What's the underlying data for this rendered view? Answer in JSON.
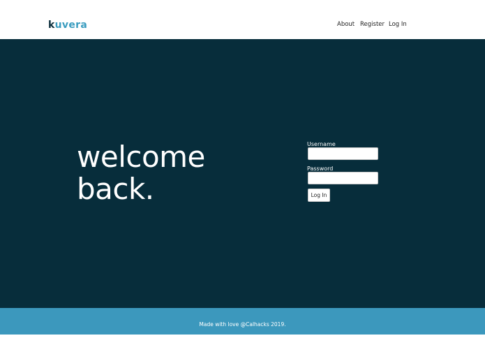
{
  "header": {
    "logo": {
      "first_letter": "k",
      "rest": "uvera"
    },
    "nav": [
      {
        "label": "About"
      },
      {
        "label": "Register"
      },
      {
        "label": "Log In"
      }
    ]
  },
  "hero": {
    "headline": {
      "line1": "welcome",
      "line2": "back."
    }
  },
  "login_form": {
    "username_label": "Username",
    "username_value": "",
    "password_label": "Password",
    "password_value": "",
    "submit_label": "Log In"
  },
  "footer": {
    "text": "Made with love @Calhacks 2019."
  },
  "colors": {
    "hero_bg": "#072d3b",
    "footer_bg": "#3c98bd",
    "logo_dark": "#0a2e3c",
    "logo_accent": "#3a9cbf"
  }
}
